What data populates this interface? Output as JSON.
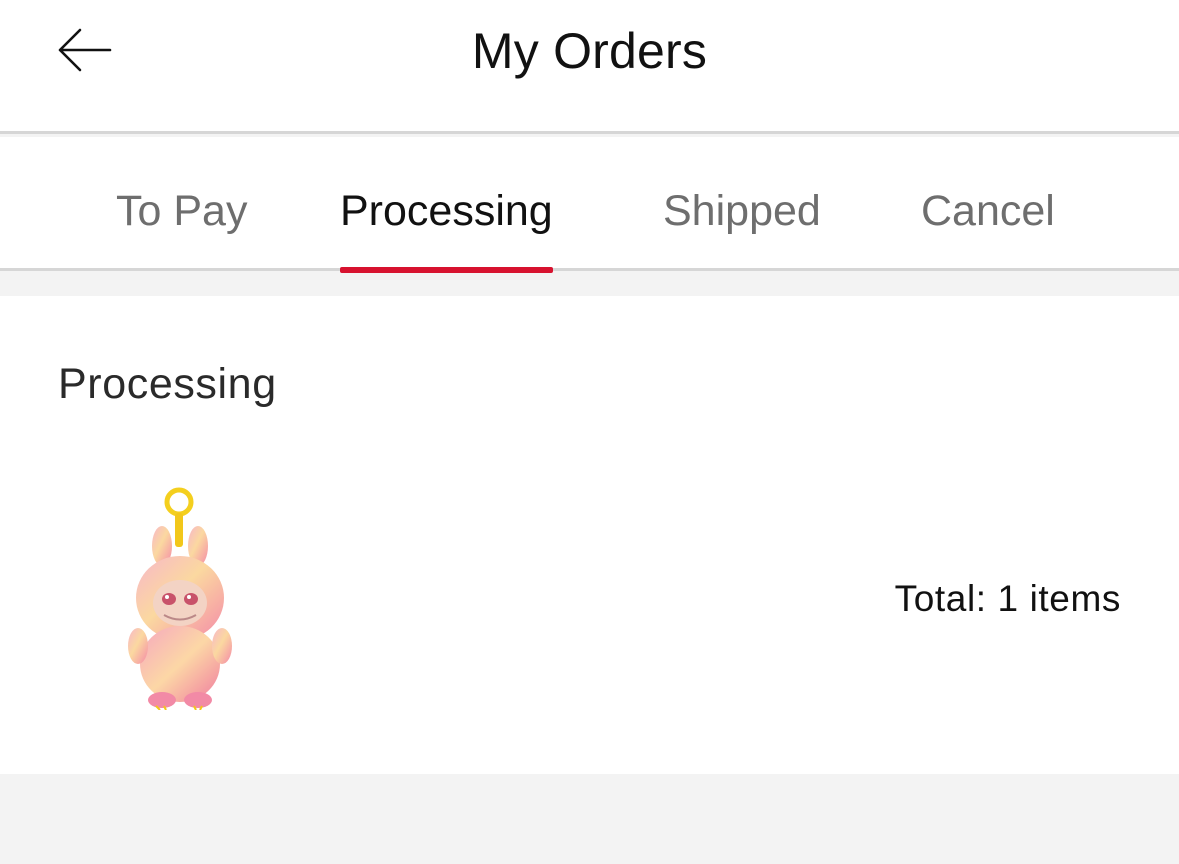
{
  "header": {
    "title": "My Orders",
    "back_icon": "arrow-left-icon"
  },
  "tabs": [
    {
      "label": "To Pay",
      "active": false
    },
    {
      "label": "Processing",
      "active": true
    },
    {
      "label": "Shipped",
      "active": false
    },
    {
      "label": "Cancel",
      "active": false
    }
  ],
  "order": {
    "status": "Processing",
    "product_image": "pink-plush-keychain-doll",
    "total_text": "Total: 1 items"
  },
  "colors": {
    "accent": "#d7122f",
    "page_bg": "#f3f3f3",
    "tab_inactive": "#6e6e6e"
  }
}
